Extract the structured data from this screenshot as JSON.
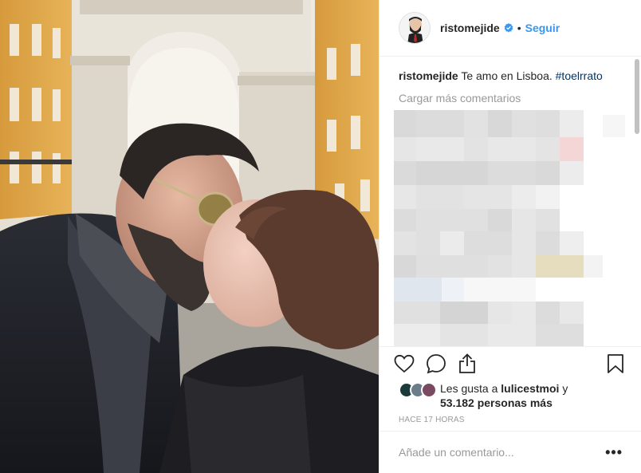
{
  "post": {
    "image_alt": "Selfie of couple kissing in front of the Arco da Rua Augusta, Lisbon"
  },
  "header": {
    "username": "ristomejide",
    "dot": "•",
    "follow_label": "Seguir"
  },
  "caption": {
    "username": "ristomejide",
    "text": "Te amo en Lisboa.",
    "hashtag": "#toelrrato"
  },
  "comments": {
    "load_more": "Cargar más comentarios"
  },
  "actions": {
    "like_icon": "heart-icon",
    "comment_icon": "speech-bubble-icon",
    "share_icon": "share-icon",
    "save_icon": "bookmark-icon"
  },
  "likes": {
    "prefix": "Les gusta a",
    "user": "lulicestmoi",
    "conjunction": "y",
    "count": "53.182 personas más"
  },
  "timestamp": "HACE 17 HORAS",
  "add_comment": {
    "placeholder": "Añade un comentario...",
    "more": "•••"
  },
  "colors": {
    "accent": "#3897f0",
    "text": "#262626",
    "muted": "#999999",
    "border": "#efefef"
  }
}
